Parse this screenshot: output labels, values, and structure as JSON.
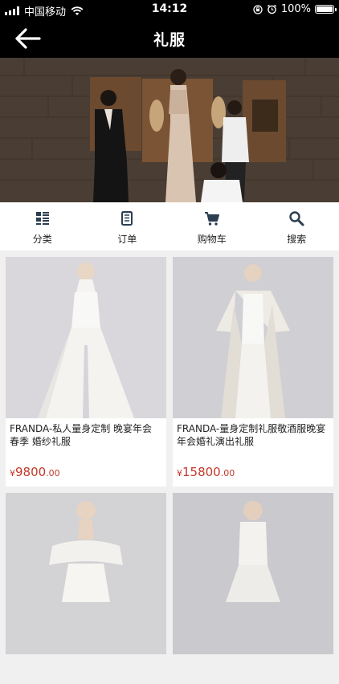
{
  "status": {
    "carrier": "中国移动",
    "time": "14:12",
    "battery": "100%"
  },
  "nav": {
    "title": "礼服"
  },
  "tabs": [
    {
      "label": "分类",
      "icon": "grid-list-icon"
    },
    {
      "label": "订单",
      "icon": "order-list-icon"
    },
    {
      "label": "购物车",
      "icon": "cart-icon"
    },
    {
      "label": "搜索",
      "icon": "search-icon"
    }
  ],
  "products": [
    {
      "name": "FRANDA-私人量身定制 晚宴年会 春季 婚纱礼服",
      "currency": "¥",
      "price_int": "9800",
      "price_dec": ".00"
    },
    {
      "name": "FRANDA-量身定制礼服敬酒服晚宴 年会婚礼演出礼服",
      "currency": "¥",
      "price_int": "15800",
      "price_dec": ".00"
    },
    {
      "name": "",
      "currency": "",
      "price_int": "",
      "price_dec": ""
    },
    {
      "name": "",
      "currency": "",
      "price_int": "",
      "price_dec": ""
    }
  ],
  "colors": {
    "bar": "#000000",
    "price": "#c0392b",
    "background": "#f0f0f0"
  }
}
